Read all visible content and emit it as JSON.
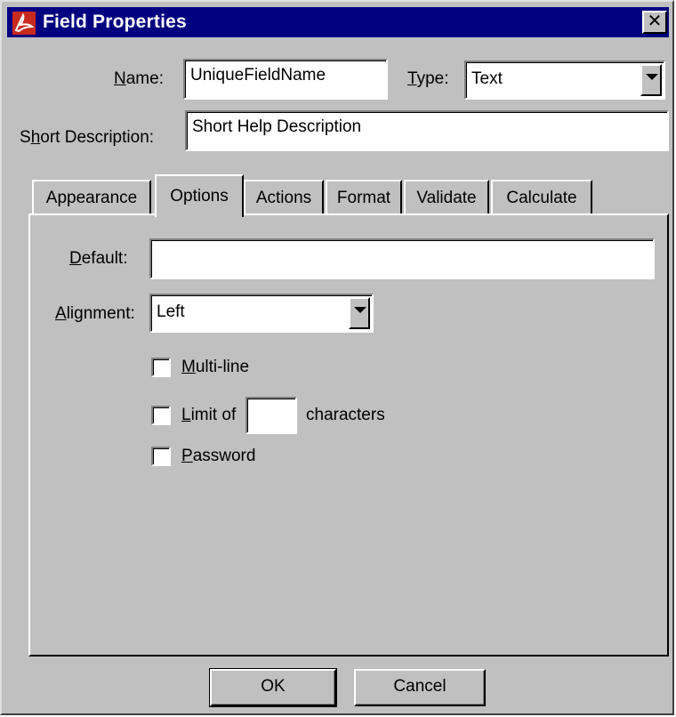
{
  "window": {
    "title": "Field Properties",
    "close_glyph": "✕",
    "icon": "acrobat-app-icon"
  },
  "general": {
    "name_label": "Name:",
    "name_value": "UniqueFieldName",
    "type_label": "Type:",
    "type_value": "Text",
    "short_description_label": "Short Description:",
    "short_description_value": "Short Help Description"
  },
  "tabs": [
    {
      "label": "Appearance",
      "active": false
    },
    {
      "label": "Options",
      "active": true
    },
    {
      "label": "Actions",
      "active": false
    },
    {
      "label": "Format",
      "active": false
    },
    {
      "label": "Validate",
      "active": false
    },
    {
      "label": "Calculate",
      "active": false
    }
  ],
  "options": {
    "default_label": "Default:",
    "default_value": "",
    "alignment_label": "Alignment:",
    "alignment_value": "Left",
    "multiline_label": "Multi-line",
    "multiline_checked": false,
    "limit_label": "Limit of",
    "limit_value": "",
    "limit_suffix": "characters",
    "limit_checked": false,
    "password_label": "Password",
    "password_checked": false
  },
  "buttons": {
    "ok": "OK",
    "cancel": "Cancel"
  },
  "colors": {
    "titlebar": "#000080",
    "face": "#c0c0c0"
  }
}
